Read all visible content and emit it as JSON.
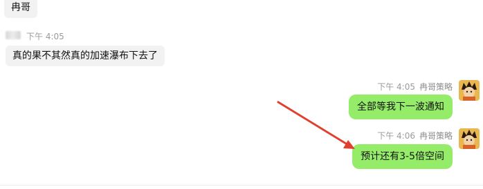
{
  "messages": [
    {
      "side": "left",
      "text": "冉哥"
    },
    {
      "side": "left",
      "time": "下午 4:05",
      "text": "真的果不其然真的加速瀑布下去了"
    },
    {
      "side": "right",
      "time": "下午 4:05",
      "sender": "冉哥策略",
      "text": "全部等我下一波通知"
    },
    {
      "side": "right",
      "time": "下午 4:06",
      "sender": "冉哥策略",
      "text": "预计还有3-5倍空间"
    }
  ],
  "annotation": {
    "arrow_color": "#e0412e"
  },
  "colors": {
    "right_bubble": "#95ec69",
    "left_bubble": "#f2f2f2"
  }
}
